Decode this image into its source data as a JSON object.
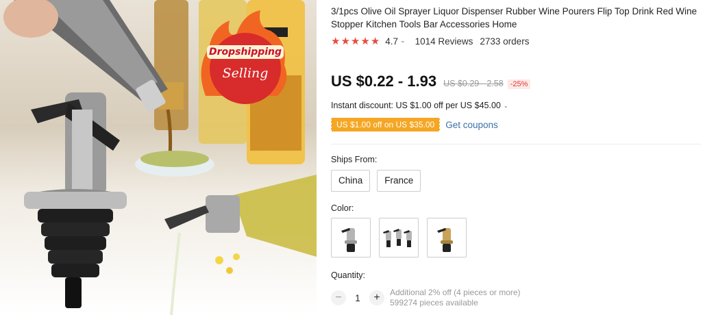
{
  "hero": {
    "badge_top": "Dropshipping",
    "badge_bottom": "Selling"
  },
  "product": {
    "title": "3/1pcs Olive Oil Sprayer Liquor Dispenser Rubber Wine Pourers Flip Top Drink Red Wine Stopper Kitchen Tools Bar Accessories Home",
    "rating": "4.7",
    "star_count": 5,
    "reviews": "1014 Reviews",
    "orders": "2733 orders",
    "price": "US $0.22 - 1.93",
    "old_price": "US $0.29 - 2.58",
    "discount": "-25%",
    "instant_discount": "Instant discount: US $1.00 off per US $45.00",
    "coupon": "US $1.00 off on US $35.00",
    "get_coupons": "Get coupons"
  },
  "ships": {
    "label": "Ships From:",
    "options": [
      "China",
      "France"
    ]
  },
  "color": {
    "label": "Color:",
    "options": [
      "silver-single",
      "silver-three-pack",
      "gold-single"
    ]
  },
  "quantity": {
    "label": "Quantity:",
    "value": "1",
    "minus": "−",
    "plus": "+",
    "note_line1": "Additional 2% off (4 pieces or more)",
    "note_line2": "599274 pieces available"
  },
  "colors": {
    "star": "#e74c3c",
    "coupon_bg": "#f5a623",
    "link": "#3a6fa8",
    "discount": "#e4393c"
  }
}
